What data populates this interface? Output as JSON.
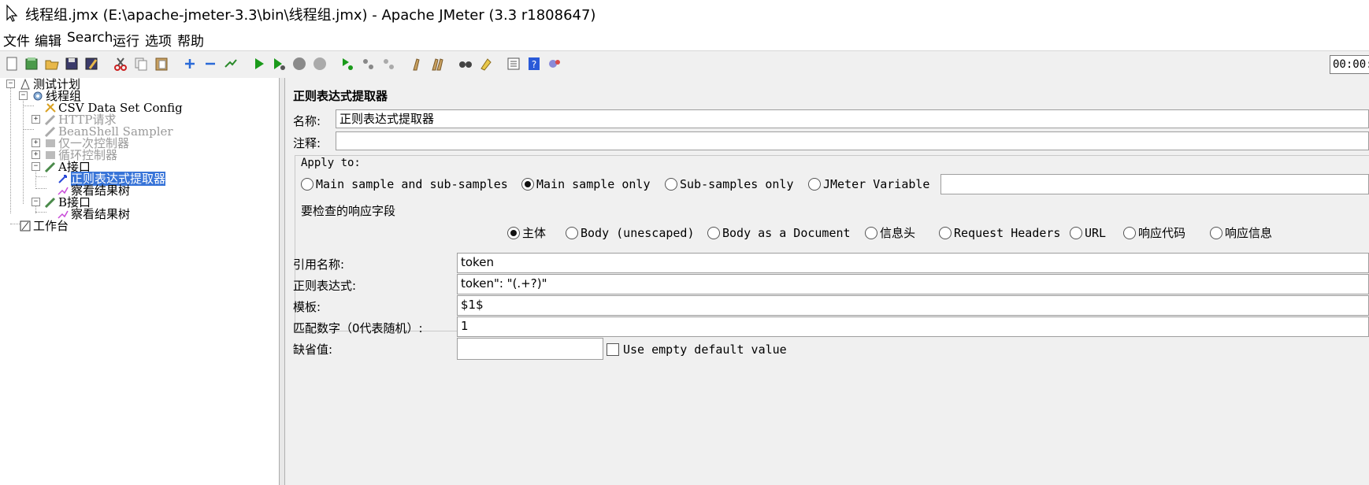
{
  "window": {
    "title": "线程组.jmx (E:\\apache-jmeter-3.3\\bin\\线程组.jmx) - Apache JMeter (3.3 r1808647)"
  },
  "menu": [
    "文件",
    "编辑",
    "Search",
    "运行",
    "选项",
    "帮助"
  ],
  "toolbar": {
    "icons": [
      "new-icon",
      "templates-icon",
      "open-icon",
      "save-icon",
      "save-as-icon",
      "cut-icon",
      "copy-icon",
      "paste-icon",
      "expand-icon",
      "collapse-icon",
      "toggle-icon",
      "start-icon",
      "start-no-pause-icon",
      "stop-icon",
      "shutdown-icon",
      "remote-start-icon",
      "remote-stop-icon",
      "remote-shutdown-icon",
      "clear-icon",
      "clear-all-icon",
      "search-icon",
      "reset-search-icon",
      "function-helper-icon",
      "help-icon",
      "log-viewer-icon"
    ],
    "timer": "00:00:"
  },
  "tree": {
    "items": [
      {
        "label": "测试计划",
        "disabled": false
      },
      {
        "label": "线程组",
        "disabled": false
      },
      {
        "label": "CSV Data Set Config",
        "disabled": false
      },
      {
        "label": "HTTP请求",
        "disabled": true
      },
      {
        "label": "BeanShell Sampler",
        "disabled": true
      },
      {
        "label": "仅一次控制器",
        "disabled": true
      },
      {
        "label": "循环控制器",
        "disabled": true
      },
      {
        "label": "A接口",
        "disabled": false
      },
      {
        "label": "正则表达式提取器",
        "disabled": false,
        "selected": true
      },
      {
        "label": "察看结果树",
        "disabled": false
      },
      {
        "label": "B接口",
        "disabled": false
      },
      {
        "label": "察看结果树",
        "disabled": false
      },
      {
        "label": "工作台",
        "disabled": false
      }
    ]
  },
  "panel": {
    "title": "正则表达式提取器",
    "name_label": "名称:",
    "name_value": "正则表达式提取器",
    "comment_label": "注释:",
    "comment_value": "",
    "apply_to": {
      "label": "Apply to:",
      "options": [
        "Main sample and sub-samples",
        "Main sample only",
        "Sub-samples only",
        "JMeter Variable"
      ],
      "selected": "Main sample only",
      "variable_value": ""
    },
    "field_to_check": {
      "label": "要检查的响应字段",
      "options": [
        "主体",
        "Body (unescaped)",
        "Body as a Document",
        "信息头",
        "Request Headers",
        "URL",
        "响应代码",
        "响应信息"
      ],
      "selected": "主体"
    },
    "ref_name_label": "引用名称:",
    "ref_name_value": "token",
    "regex_label": "正则表达式:",
    "regex_value": "token\": \"(.+?)\"",
    "template_label": "模板:",
    "template_value": "$1$",
    "match_no_label": "匹配数字（0代表随机）:",
    "match_no_value": "1",
    "default_label": "缺省值:",
    "default_value": "",
    "use_empty_default_label": "Use empty default value",
    "use_empty_default_checked": false
  }
}
